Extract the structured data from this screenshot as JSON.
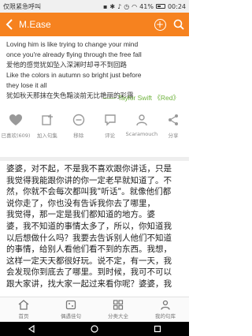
{
  "status_bar": {
    "carrier": "仅限紧急呼叫",
    "battery": "41%",
    "time": "00:24"
  },
  "header": {
    "title": "M.Ease"
  },
  "quote": {
    "lines": [
      "Loving him is like trying to change your mind",
      "once you're already flying through the free fall",
      "爱他的感觉犹如坠入深渊时却寻不到回路",
      "Like the colors in autumn so bright just before",
      "they lose it all",
      "犹如秋天那抹在失色黯淡前无比艳丽的彩霭"
    ],
    "attribution": "—— Taylor Swift 《Red》"
  },
  "actions": [
    {
      "label": "已喜欢(609)",
      "icon": "heart-icon"
    },
    {
      "label": "加入句集",
      "icon": "collection-icon"
    },
    {
      "label": "移除",
      "icon": "remove-icon"
    },
    {
      "label": "评论",
      "icon": "comment-icon"
    },
    {
      "label": "Scaramouch",
      "icon": "user-icon"
    },
    {
      "label": "分享",
      "icon": "share-icon"
    }
  ],
  "body_lines": [
    "婆婆，对不起，不是我不喜欢跟你讲话，只是",
    "我觉得我能跟你讲的你一定老早就知道了。不",
    "然，你就不会每次都叫我\"听话\"。就像他们都",
    "说你走了，你也没有告诉我你去了哪里，",
    "我觉得，那一定是我们都知道的地方。婆",
    "婆，我不知道的事情太多了，所以，你知道我",
    "以后想做什么吗？我要去告诉别人他们不知道",
    "的事情，给别人看他们看不到的东西。我想，",
    "这样一定天天都很好玩。说不定，有一天，我",
    "会发现你到底去了哪里。到时候，我可不可以",
    "跟大家讲，找大家一起过来看你呢？婆婆，我"
  ],
  "bottom_nav": [
    {
      "label": "首页",
      "icon": "home-icon"
    },
    {
      "label": "偶遇佳句",
      "icon": "random-quote-icon"
    },
    {
      "label": "分类大全",
      "icon": "categories-icon"
    },
    {
      "label": "我的句库",
      "icon": "my-library-icon"
    }
  ],
  "colors": {
    "header_bg": "#f6821f",
    "attribution": "#6fb33d",
    "system_nav_bg": "#000000"
  }
}
